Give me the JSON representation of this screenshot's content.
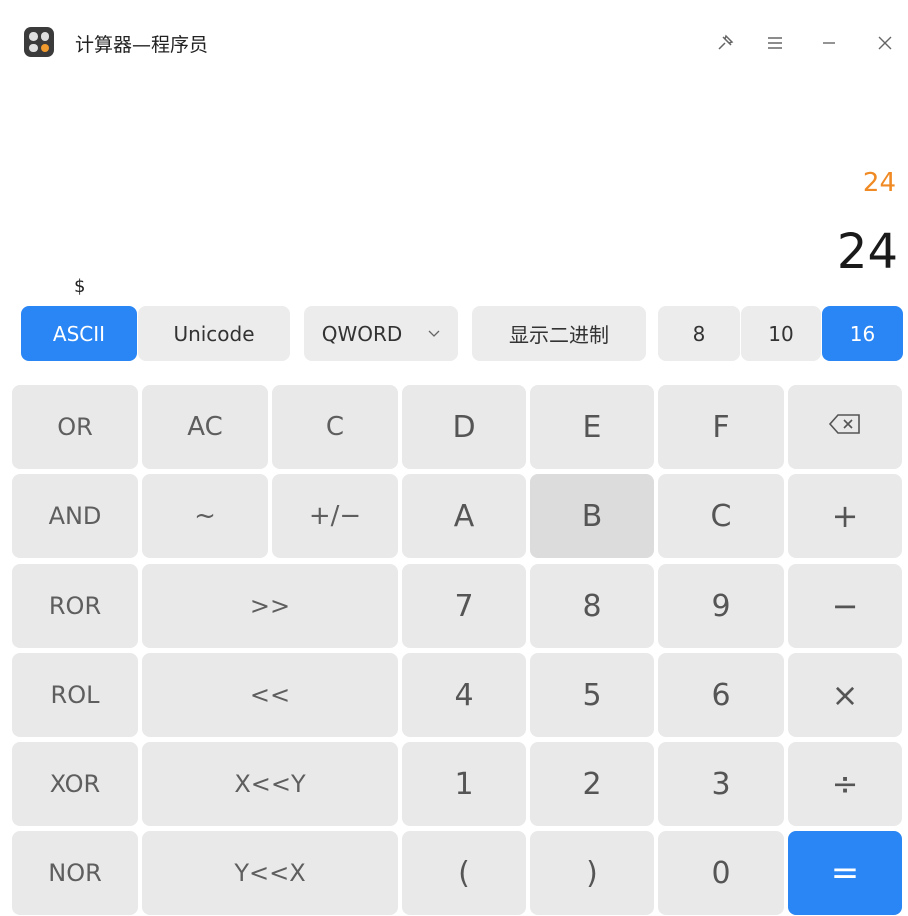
{
  "window": {
    "title": "计算器—程序员",
    "controls": {
      "pin": "✗",
      "menu": "≡",
      "minimize": "–",
      "close": "×"
    }
  },
  "display": {
    "expression": "24",
    "result": "24",
    "ascii_char": "$"
  },
  "controls": {
    "ascii": "ASCII",
    "unicode": "Unicode",
    "word_size": "QWORD",
    "show_binary": "显示二进制",
    "bases": [
      "8",
      "10",
      "16"
    ],
    "active_base": "16"
  },
  "keys": {
    "or": "OR",
    "ac": "AC",
    "clear": "C",
    "d": "D",
    "e": "E",
    "f": "F",
    "backspace": "⌫",
    "and": "AND",
    "not": "~",
    "negate": "+/−",
    "a": "A",
    "b": "B",
    "c": "C",
    "plus": "+",
    "ror": "ROR",
    "shr": ">>",
    "n7": "7",
    "n8": "8",
    "n9": "9",
    "minus": "−",
    "rol": "ROL",
    "shl": "<<",
    "n4": "4",
    "n5": "5",
    "n6": "6",
    "multiply": "×",
    "xor": "XOR",
    "xshly": "X<<Y",
    "n1": "1",
    "n2": "2",
    "n3": "3",
    "divide": "÷",
    "nor": "NOR",
    "yshlx": "Y<<X",
    "lparen": "(",
    "rparen": ")",
    "n0": "0",
    "equals": "="
  },
  "colors": {
    "accent": "#2a86f4",
    "expression": "#f08a24",
    "key_bg": "#e9e9e9"
  }
}
